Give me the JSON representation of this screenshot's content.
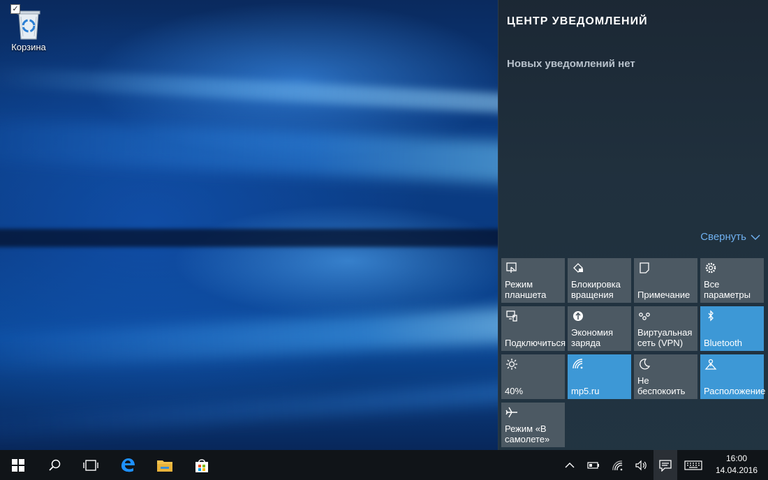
{
  "desktop": {
    "recycle_bin_label": "Корзина"
  },
  "action_center": {
    "title": "ЦЕНТР УВЕДОМЛЕНИЙ",
    "empty_text": "Новых уведомлений нет",
    "collapse_label": "Свернуть",
    "accent_color": "#3d98d6",
    "tiles": [
      {
        "label": "Режим планшета",
        "icon": "tablet-mode-icon",
        "active": false
      },
      {
        "label": "Блокировка вращения",
        "icon": "rotation-lock-icon",
        "active": false
      },
      {
        "label": "Примечание",
        "icon": "note-icon",
        "active": false
      },
      {
        "label": "Все параметры",
        "icon": "settings-icon",
        "active": false
      },
      {
        "label": "Подключиться",
        "icon": "connect-icon",
        "active": false
      },
      {
        "label": "Экономия заряда",
        "icon": "battery-saver-icon",
        "active": false
      },
      {
        "label": "Виртуальная сеть (VPN)",
        "icon": "vpn-icon",
        "active": false
      },
      {
        "label": "Bluetooth",
        "icon": "bluetooth-icon",
        "active": true
      },
      {
        "label": "40%",
        "icon": "brightness-icon",
        "active": false
      },
      {
        "label": "mp5.ru",
        "icon": "wifi-icon",
        "active": true
      },
      {
        "label": "Не беспокоить",
        "icon": "moon-icon",
        "active": false
      },
      {
        "label": "Расположение",
        "icon": "location-icon",
        "active": true
      },
      {
        "label": "Режим «В самолете»",
        "icon": "airplane-icon",
        "active": false
      }
    ]
  },
  "taskbar": {
    "pinned": [
      "start-icon",
      "search-icon",
      "task-view-icon",
      "edge-icon",
      "file-explorer-icon",
      "store-icon"
    ],
    "tray": [
      "chevron-up-icon",
      "battery-icon",
      "wifi-icon",
      "volume-icon",
      "action-center-icon",
      "keyboard-icon"
    ],
    "time": "16:00",
    "date": "14.04.2016"
  }
}
